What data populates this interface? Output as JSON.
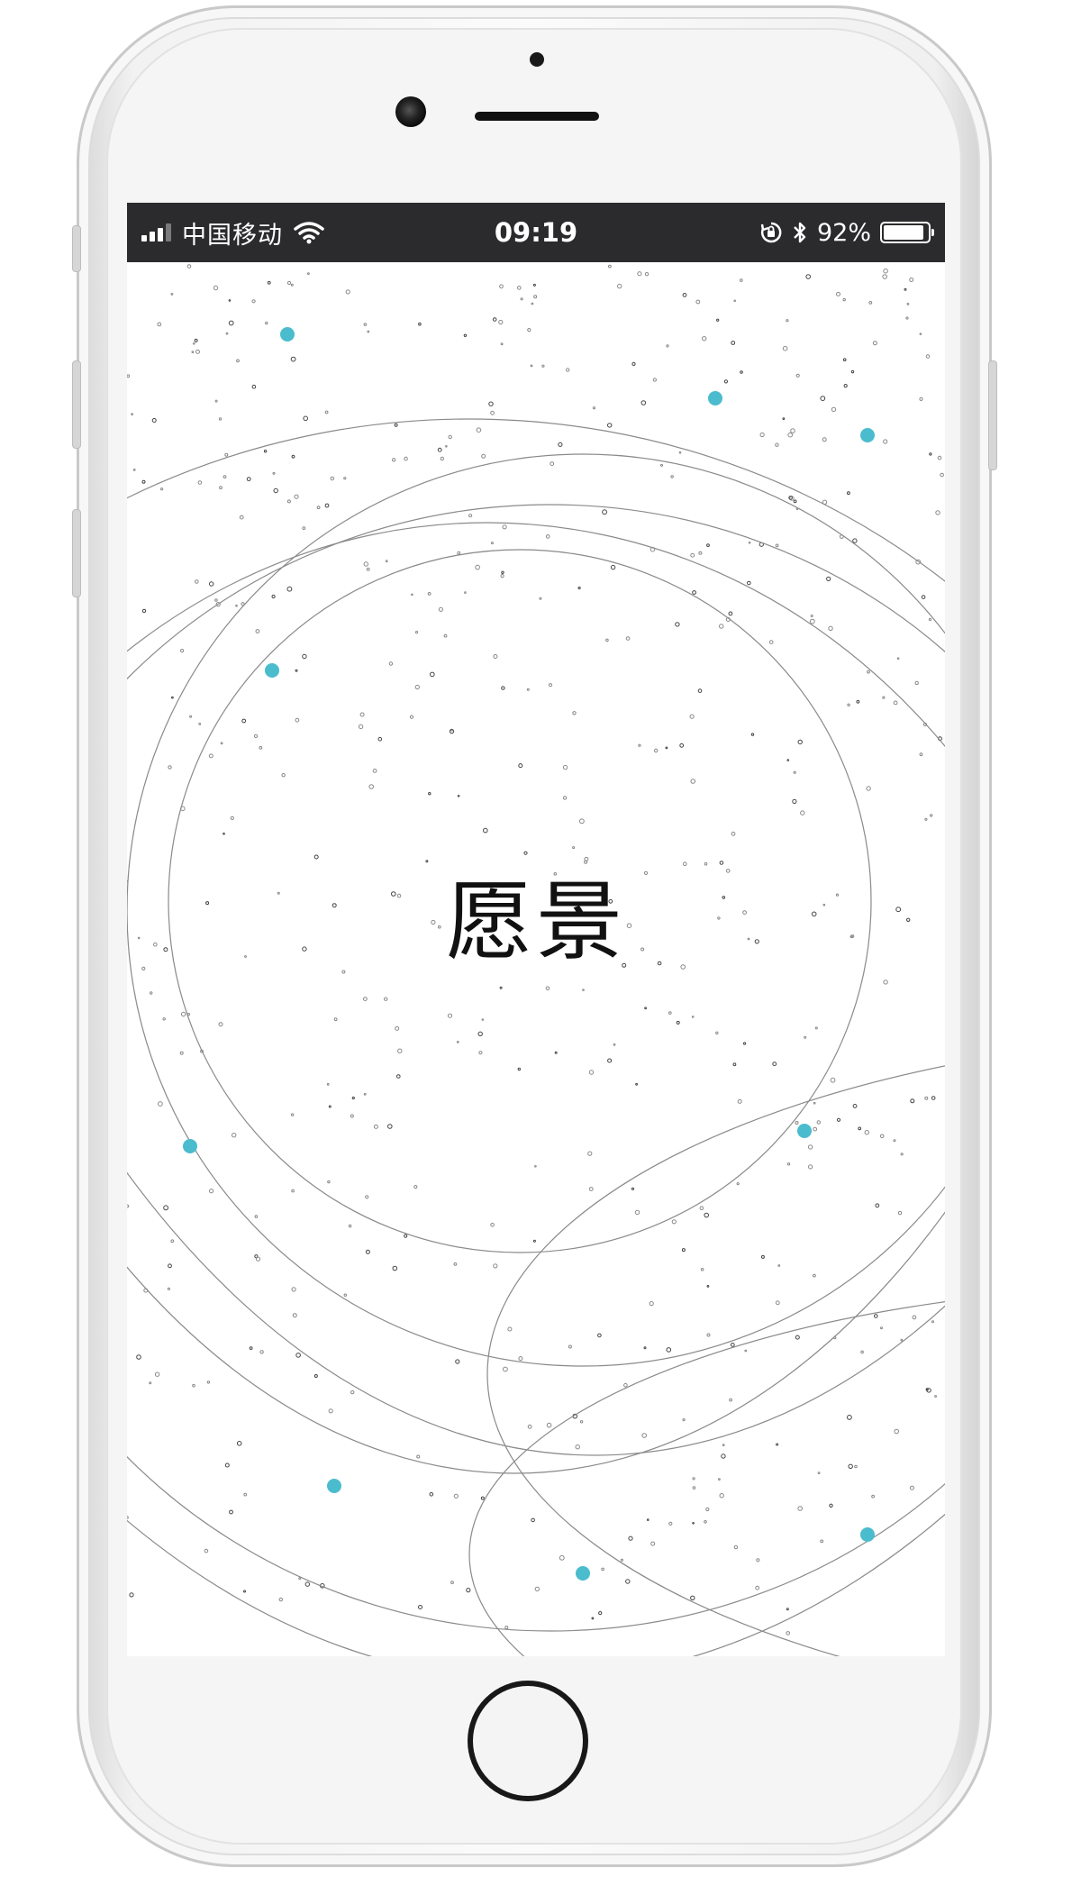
{
  "status_bar": {
    "carrier": "中国移动",
    "time": "09:19",
    "battery_percent": "92%",
    "battery_level": 0.92,
    "signal_bars": 3,
    "signal_bars_total": 4,
    "icons": [
      "signal-icon",
      "wifi-icon",
      "orientation-lock-icon",
      "bluetooth-icon",
      "battery-icon"
    ]
  },
  "main": {
    "title": "愿景"
  },
  "colors": {
    "status_bar_bg": "#2b2b2d",
    "orbit_line": "#8a8a8a",
    "node_accent": "#4bbccd",
    "screen_bg": "#ffffff"
  }
}
